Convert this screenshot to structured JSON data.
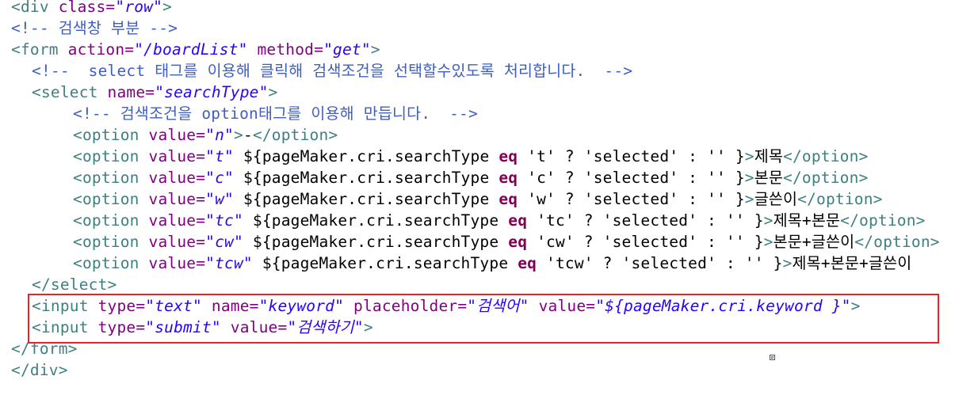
{
  "lines": [
    [
      {
        "t": "<div ",
        "c": "tag"
      },
      {
        "t": "class=",
        "c": "an"
      },
      {
        "t": "\"row\"",
        "c": "av"
      },
      {
        "t": ">",
        "c": "tag"
      }
    ],
    [
      {
        "t": "<!-- 검색창 부분 -->",
        "c": "cm"
      }
    ],
    [
      {
        "t": "<form ",
        "c": "tag"
      },
      {
        "t": "action=",
        "c": "an"
      },
      {
        "t": "\"/boardList\"",
        "c": "av"
      },
      {
        "t": " ",
        "c": "tx"
      },
      {
        "t": "method=",
        "c": "an"
      },
      {
        "t": "\"get\"",
        "c": "av"
      },
      {
        "t": ">",
        "c": "tag"
      }
    ],
    [
      {
        "t": "<!--  select 태그를 이용해 클릭해 검색조건을 선택할수있도록 처리합니다.  -->",
        "c": "cm"
      }
    ],
    [
      {
        "t": "<select ",
        "c": "tag"
      },
      {
        "t": "name=",
        "c": "an"
      },
      {
        "t": "\"searchType\"",
        "c": "av"
      },
      {
        "t": ">",
        "c": "tag"
      }
    ],
    [
      {
        "t": "<!-- 검색조건을 option태그를 이용해 만듭니다.  -->",
        "c": "cm"
      }
    ],
    [
      {
        "t": "<option ",
        "c": "tag"
      },
      {
        "t": "value=",
        "c": "an"
      },
      {
        "t": "\"n\"",
        "c": "av"
      },
      {
        "t": ">",
        "c": "tag"
      },
      {
        "t": "-",
        "c": "tx"
      },
      {
        "t": "</option>",
        "c": "tag"
      }
    ],
    [
      {
        "t": "<option ",
        "c": "tag"
      },
      {
        "t": "value=",
        "c": "an"
      },
      {
        "t": "\"t\"",
        "c": "av"
      },
      {
        "t": " ${pageMaker.cri.searchType ",
        "c": "tx"
      },
      {
        "t": "eq",
        "c": "kw"
      },
      {
        "t": " 't' ? 'selected' : '' }",
        "c": "tx"
      },
      {
        "t": ">",
        "c": "tag"
      },
      {
        "t": "제목",
        "c": "tx"
      },
      {
        "t": "</option>",
        "c": "tag"
      }
    ],
    [
      {
        "t": "<option ",
        "c": "tag"
      },
      {
        "t": "value=",
        "c": "an"
      },
      {
        "t": "\"c\"",
        "c": "av"
      },
      {
        "t": " ${pageMaker.cri.searchType ",
        "c": "tx"
      },
      {
        "t": "eq",
        "c": "kw"
      },
      {
        "t": " 'c' ? 'selected' : '' }",
        "c": "tx"
      },
      {
        "t": ">",
        "c": "tag"
      },
      {
        "t": "본문",
        "c": "tx"
      },
      {
        "t": "</option>",
        "c": "tag"
      }
    ],
    [
      {
        "t": "<option ",
        "c": "tag"
      },
      {
        "t": "value=",
        "c": "an"
      },
      {
        "t": "\"w\"",
        "c": "av"
      },
      {
        "t": " ${pageMaker.cri.searchType ",
        "c": "tx"
      },
      {
        "t": "eq",
        "c": "kw"
      },
      {
        "t": " 'w' ? 'selected' : '' }",
        "c": "tx"
      },
      {
        "t": ">",
        "c": "tag"
      },
      {
        "t": "글쓴이",
        "c": "tx"
      },
      {
        "t": "</option>",
        "c": "tag"
      }
    ],
    [
      {
        "t": "<option ",
        "c": "tag"
      },
      {
        "t": "value=",
        "c": "an"
      },
      {
        "t": "\"tc\"",
        "c": "av"
      },
      {
        "t": " ${pageMaker.cri.searchType ",
        "c": "tx"
      },
      {
        "t": "eq",
        "c": "kw"
      },
      {
        "t": " 'tc' ? 'selected' : '' }",
        "c": "tx"
      },
      {
        "t": ">",
        "c": "tag"
      },
      {
        "t": "제목+본문",
        "c": "tx"
      },
      {
        "t": "</option>",
        "c": "tag"
      }
    ],
    [
      {
        "t": "<option ",
        "c": "tag"
      },
      {
        "t": "value=",
        "c": "an"
      },
      {
        "t": "\"cw\"",
        "c": "av"
      },
      {
        "t": " ${pageMaker.cri.searchType ",
        "c": "tx"
      },
      {
        "t": "eq",
        "c": "kw"
      },
      {
        "t": " 'cw' ? 'selected' : '' }",
        "c": "tx"
      },
      {
        "t": ">",
        "c": "tag"
      },
      {
        "t": "본문+글쓴이",
        "c": "tx"
      },
      {
        "t": "</option>",
        "c": "tag"
      }
    ],
    [
      {
        "t": "<option ",
        "c": "tag"
      },
      {
        "t": "value=",
        "c": "an"
      },
      {
        "t": "\"tcw\"",
        "c": "av"
      },
      {
        "t": " ${pageMaker.cri.searchType ",
        "c": "tx"
      },
      {
        "t": "eq",
        "c": "kw"
      },
      {
        "t": " 'tcw' ? 'selected' : '' }",
        "c": "tx"
      },
      {
        "t": ">",
        "c": "tag"
      },
      {
        "t": "제목+본문+글쓴이",
        "c": "tx"
      }
    ],
    [
      {
        "t": "</select>",
        "c": "tag"
      }
    ],
    [
      {
        "t": "<input ",
        "c": "tag"
      },
      {
        "t": "type=",
        "c": "an"
      },
      {
        "t": "\"text\"",
        "c": "av"
      },
      {
        "t": " ",
        "c": "tx"
      },
      {
        "t": "name=",
        "c": "an"
      },
      {
        "t": "\"keyword\"",
        "c": "av"
      },
      {
        "t": " ",
        "c": "tx"
      },
      {
        "t": "placeholder=",
        "c": "an"
      },
      {
        "t": "\"검색어\"",
        "c": "av"
      },
      {
        "t": " ",
        "c": "tx"
      },
      {
        "t": "value=",
        "c": "an"
      },
      {
        "t": "\"${pageMaker.cri.keyword }\"",
        "c": "av"
      },
      {
        "t": ">",
        "c": "tag"
      }
    ],
    [
      {
        "t": "<input ",
        "c": "tag"
      },
      {
        "t": "type=",
        "c": "an"
      },
      {
        "t": "\"submit\"",
        "c": "av"
      },
      {
        "t": " ",
        "c": "tx"
      },
      {
        "t": "value=",
        "c": "an"
      },
      {
        "t": "\"검색하기\"",
        "c": "av"
      },
      {
        "t": ">",
        "c": "tag"
      }
    ],
    [
      {
        "t": "</form>",
        "c": "tag"
      }
    ],
    [
      {
        "t": "</div>",
        "c": "tag"
      }
    ]
  ],
  "colors": {
    "tag": "#3f7f7f",
    "attribute_name": "#7f007f",
    "attribute_value": "#2a00ff",
    "comment": "#3f5fbf",
    "text": "#000000",
    "keyword": "#7f0055",
    "highlight_border": "#e0262b"
  }
}
